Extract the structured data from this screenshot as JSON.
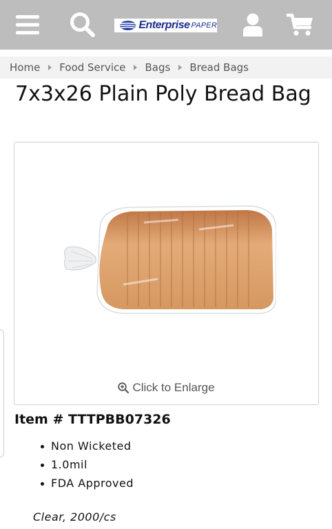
{
  "header": {
    "logo_text_main": "Enterprise",
    "logo_text_sub": "PAPER",
    "icons": [
      "menu-icon",
      "search-icon",
      "user-icon",
      "cart-icon"
    ],
    "background_color": "#bdbdbd"
  },
  "breadcrumb": {
    "items": [
      "Home",
      "Food Service",
      "Bags",
      "Bread Bags"
    ]
  },
  "product": {
    "title": "7x3x26 Plain Poly Bread Bag",
    "image_alt": "bread-in-plastic-bag",
    "enlarge_label": "Click to Enlarge",
    "item_number": "Item # TTTPBB07326",
    "features": [
      "Non Wicketed",
      "1.0mil",
      "FDA Approved"
    ],
    "pack_info": "Clear, 2000/cs"
  }
}
